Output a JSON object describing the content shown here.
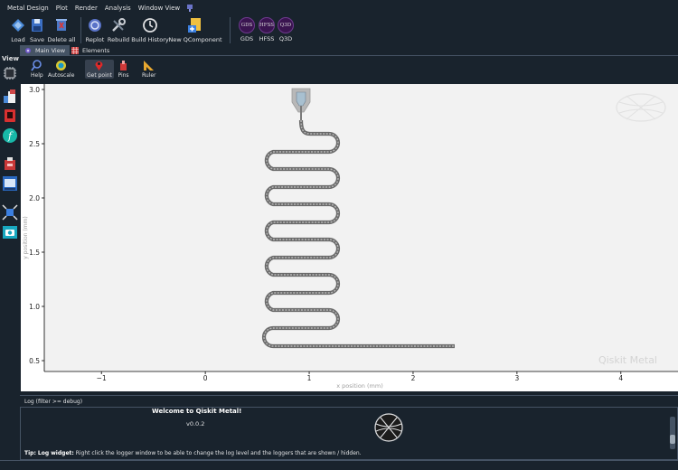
{
  "menu": [
    "Metal Design",
    "Plot",
    "Render",
    "Analysis",
    "Window View"
  ],
  "toolbar": {
    "load": "Load",
    "save": "Save",
    "delete_all": "Delete all",
    "replot": "Replot",
    "rebuild": "Rebuild",
    "build_history": "Build History",
    "new_qcomponent": "New QComponent",
    "gds": "GDS",
    "hfss": "HFSS",
    "q3d": "Q3D",
    "gds_icon_text": "GDS",
    "hfss_icon_text": "HFSS",
    "q3d_icon_text": "Q3D"
  },
  "tabs": {
    "main_view": "Main View",
    "elements": "Elements"
  },
  "dock": {
    "view_title": "View"
  },
  "plot_toolbar": {
    "help": "Help",
    "autoscale": "Autoscale",
    "get_point": "Get point",
    "pins": "Pins",
    "ruler": "Ruler"
  },
  "plot": {
    "xlabel": "x position (mm)",
    "ylabel": "y position (mm)",
    "watermark": "Qiskit Metal",
    "xlim": [
      -1.55,
      4.55
    ],
    "ylim": [
      0.4,
      3.05
    ],
    "xticks": [
      -1,
      0,
      1,
      2,
      3,
      4
    ],
    "xtick_labels": [
      "−1",
      "0",
      "1",
      "2",
      "3",
      "4"
    ],
    "yticks": [
      0.5,
      1.0,
      1.5,
      2.0,
      2.5,
      3.0
    ],
    "ytick_labels": [
      "0.5",
      "1.0",
      "1.5",
      "2.0",
      "2.5",
      "3.0"
    ]
  },
  "log": {
    "title": "Log  (filter >= debug)",
    "welcome": "Welcome to Qiskit Metal!",
    "version": "v0.0.2",
    "tip_bold": "Tip: Log widget:",
    "tip_text": " Right click the logger window to be able to change the log level and the loggers that are shown / hidden."
  },
  "colors": {
    "background": "#19232d",
    "panel_border": "#455364",
    "plot_background": "#ffffff",
    "meander": "#7a7a7a",
    "qcomponent_circle": "#3a1450"
  }
}
